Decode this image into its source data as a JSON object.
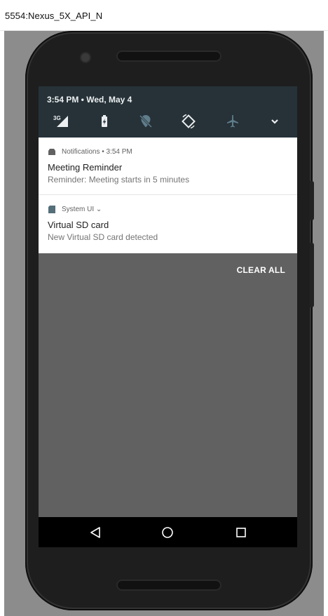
{
  "window": {
    "title": "5554:Nexus_5X_API_N"
  },
  "status": {
    "datetime": "3:54 PM • Wed, May 4",
    "network_label": "3G"
  },
  "quick_settings": [
    {
      "icon": "signal-3g-icon"
    },
    {
      "icon": "battery-charging-icon"
    },
    {
      "icon": "location-off-icon"
    },
    {
      "icon": "auto-rotate-icon"
    },
    {
      "icon": "airplane-mode-icon"
    },
    {
      "icon": "expand-chevron-icon"
    }
  ],
  "notifications": [
    {
      "app": "Notifications • 3:54 PM",
      "title": "Meeting Reminder",
      "text": "Reminder: Meeting starts in 5 minutes"
    },
    {
      "app": "System UI ⌄",
      "title": "Virtual SD card",
      "text": "New Virtual SD card detected"
    }
  ],
  "actions": {
    "clear_all": "CLEAR ALL"
  },
  "nav": {
    "back": "back-icon",
    "home": "home-icon",
    "recents": "recents-icon"
  },
  "colors": {
    "shade_header": "#263238",
    "screen_background": "#616161",
    "notification_background": "#ffffff",
    "nav_bar": "#000000"
  }
}
